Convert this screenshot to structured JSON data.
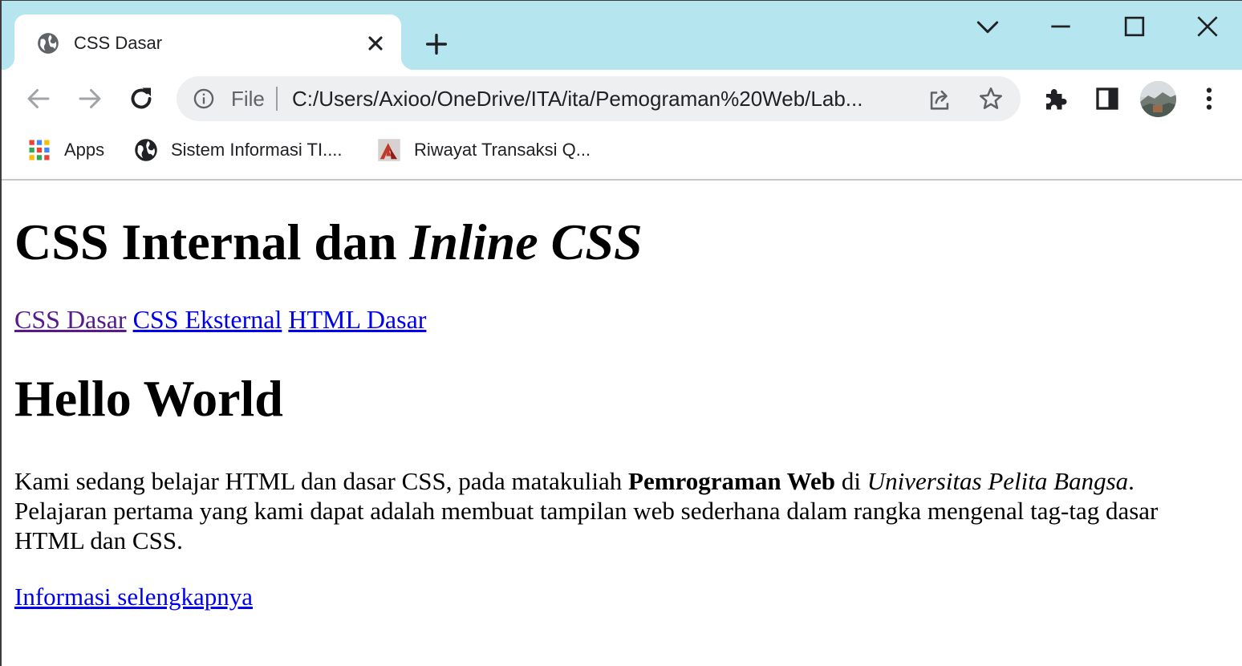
{
  "browser": {
    "tab": {
      "title": "CSS Dasar"
    },
    "window_controls": [
      "tab-search",
      "minimize",
      "maximize",
      "close"
    ],
    "omnibox": {
      "scheme_label": "File",
      "url": "C:/Users/Axioo/OneDrive/ITA/ita/Pemograman%20Web/Lab..."
    },
    "bookmarks": [
      {
        "label": "Apps",
        "icon": "apps-grid-icon"
      },
      {
        "label": "Sistem Informasi TI....",
        "icon": "globe-icon"
      },
      {
        "label": "Riwayat Transaksi Q...",
        "icon": "site-favicon-icon"
      }
    ],
    "colors": {
      "tabstrip": "#b5e6f0",
      "omnibox": "#eeeff0",
      "link": "#0000ee",
      "link_visited": "#551a8b"
    }
  },
  "page": {
    "title_main": "CSS Internal dan ",
    "title_italic": "Inline CSS",
    "nav": [
      {
        "label": "CSS Dasar",
        "visited": true
      },
      {
        "label": "CSS Eksternal",
        "visited": false
      },
      {
        "label": "HTML Dasar",
        "visited": false
      }
    ],
    "heading": "Hello World",
    "paragraph": {
      "part1": "Kami sedang belajar HTML dan dasar CSS, pada matakuliah ",
      "bold": "Pemrograman Web",
      "part2": " di ",
      "italic": "Universitas Pelita Bangsa",
      "part3": ". Pelajaran pertama yang kami dapat adalah membuat tampilan web sederhana dalam rangka mengenal tag-tag dasar HTML dan CSS."
    },
    "more_link": "Informasi selengkapnya"
  }
}
